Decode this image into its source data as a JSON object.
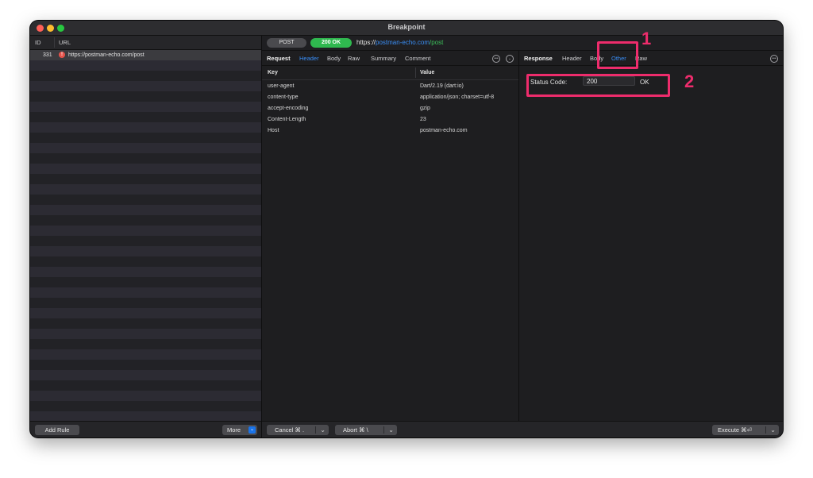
{
  "window": {
    "title": "Breakpoint"
  },
  "sidebar": {
    "columns": {
      "id": "ID",
      "url": "URL"
    },
    "rows": [
      {
        "id": "331",
        "url": "https://postman-echo.com/post",
        "status_icon": "error-icon"
      }
    ],
    "add_rule_label": "Add Rule",
    "more_label": "More",
    "more_icon": "chevron-down-icon"
  },
  "urlbar": {
    "method": "POST",
    "status": "200 OK",
    "url_scheme": "https://",
    "url_host": "postman-echo.com",
    "url_path": "/post"
  },
  "request": {
    "title": "Request",
    "tabs": [
      "Header",
      "Body",
      "Raw",
      "Summary",
      "Comment"
    ],
    "active_tab": "Header",
    "columns": {
      "key": "Key",
      "value": "Value"
    },
    "headers": [
      {
        "key": "user-agent",
        "value": "Dart/2.19 (dart:io)"
      },
      {
        "key": "content-type",
        "value": "application/json; charset=utf-8"
      },
      {
        "key": "accept-encoding",
        "value": "gzip"
      },
      {
        "key": "Content-Length",
        "value": "23"
      },
      {
        "key": "Host",
        "value": "postman-echo.com"
      }
    ]
  },
  "response": {
    "title": "Response",
    "tabs": [
      "Header",
      "Body",
      "Other",
      "Raw"
    ],
    "active_tab": "Other",
    "status_code_label": "Status Code:",
    "status_code_value": "200",
    "status_text": "OK"
  },
  "footer": {
    "cancel_label": "Cancel ⌘ .",
    "abort_label": "Abort ⌘ \\",
    "execute_label": "Execute ⌘⏎"
  },
  "annotations": {
    "one": "1",
    "two": "2",
    "color": "#ee2c6c"
  },
  "colors": {
    "accent": "#3a8ef6",
    "ok_green": "#2fb84f",
    "error_red": "#e5534b"
  }
}
